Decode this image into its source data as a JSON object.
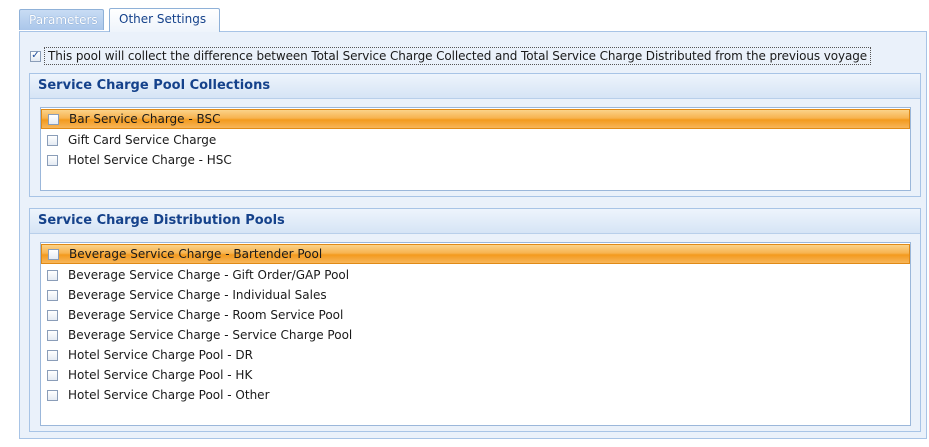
{
  "tabs": [
    {
      "label": "Parameters",
      "active": false
    },
    {
      "label": "Other Settings",
      "active": true
    }
  ],
  "collect_difference": {
    "checked": true,
    "label": "This pool will collect the difference between Total Service Charge Collected and Total Service Charge Distributed from the previous voyage"
  },
  "collections": {
    "title": "Service Charge Pool Collections",
    "items": [
      {
        "label": "Bar Service Charge - BSC",
        "checked": false,
        "selected": true
      },
      {
        "label": "Gift Card Service Charge",
        "checked": false,
        "selected": false
      },
      {
        "label": "Hotel Service Charge - HSC",
        "checked": false,
        "selected": false
      }
    ]
  },
  "distribution": {
    "title": "Service Charge Distribution Pools",
    "items": [
      {
        "label": "Beverage Service Charge - Bartender Pool",
        "checked": false,
        "selected": true
      },
      {
        "label": "Beverage Service Charge - Gift Order/GAP Pool",
        "checked": false,
        "selected": false
      },
      {
        "label": "Beverage Service Charge - Individual Sales",
        "checked": false,
        "selected": false
      },
      {
        "label": "Beverage Service Charge - Room Service Pool",
        "checked": false,
        "selected": false
      },
      {
        "label": "Beverage Service Charge - Service Charge Pool",
        "checked": false,
        "selected": false
      },
      {
        "label": "Hotel Service Charge Pool - DR",
        "checked": false,
        "selected": false
      },
      {
        "label": "Hotel Service Charge Pool - HK",
        "checked": false,
        "selected": false
      },
      {
        "label": "Hotel Service Charge Pool - Other",
        "checked": false,
        "selected": false
      }
    ]
  },
  "colors": {
    "header_text": "#15428b",
    "selection": "#f39a1e",
    "panel_bg": "#eaf1fa"
  }
}
